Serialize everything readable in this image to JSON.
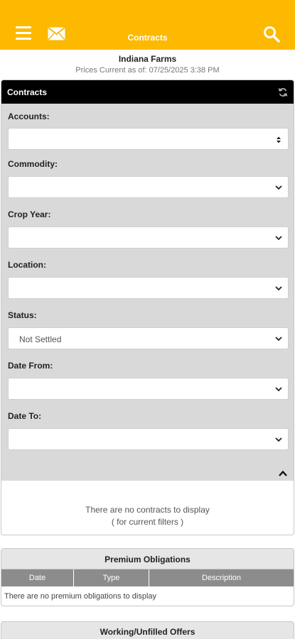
{
  "header": {
    "title": "Contracts",
    "menu_icon": "hamburger-menu-icon",
    "mail_icon": "envelope-icon",
    "search_icon": "search-icon",
    "accent_color": "#fcb900"
  },
  "farm_name": "Indiana Farms",
  "prices_current": "Prices Current as of: 07/25/2025 3:38 PM",
  "contracts_panel": {
    "title": "Contracts",
    "refresh_icon": "refresh-icon",
    "filters": [
      {
        "label": "Accounts:",
        "value": ""
      },
      {
        "label": "Commodity:",
        "value": ""
      },
      {
        "label": "Crop Year:",
        "value": ""
      },
      {
        "label": "Location:",
        "value": ""
      },
      {
        "label": "Status:",
        "value": "Not Settled"
      },
      {
        "label": "Date From:",
        "value": ""
      },
      {
        "label": "Date To:",
        "value": ""
      }
    ],
    "empty_line1": "There are no contracts to display",
    "empty_line2": "( for current filters )"
  },
  "premium": {
    "title": "Premium Obligations",
    "columns": [
      "Date",
      "Type",
      "Description"
    ],
    "empty": "There are no premium obligations to display"
  },
  "working": {
    "title": "Working/Unfilled Offers"
  }
}
